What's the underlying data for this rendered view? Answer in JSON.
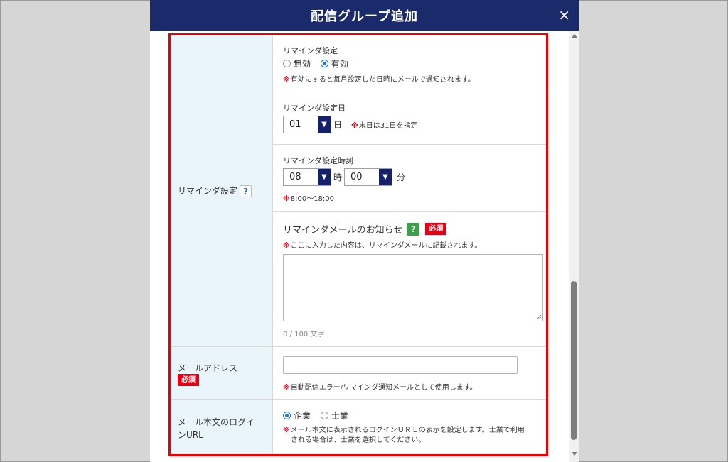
{
  "modal": {
    "title": "配信グループ追加",
    "close_glyph": "×"
  },
  "reminder": {
    "section_label": "リマインダ設定",
    "help_glyph": "?",
    "setting": {
      "label": "リマインダ設定",
      "options": [
        "無効",
        "有効"
      ],
      "selected": "有効",
      "note_mark": "※",
      "note": "有効にすると毎月設定した日時にメールで通知されます。"
    },
    "day": {
      "label": "リマインダ設定日",
      "value": "01",
      "unit": "日",
      "note_mark": "※",
      "note": "末日は31日を指定"
    },
    "time": {
      "label": "リマインダ設定時刻",
      "hour": "08",
      "hour_unit": "時",
      "minute": "00",
      "minute_unit": "分",
      "note_mark": "※",
      "note": "8:00〜18:00"
    },
    "message": {
      "label": "リマインダメールのお知らせ",
      "help_glyph": "?",
      "required": "必須",
      "note_mark": "※",
      "note": "ここに入力した内容は、リマインダメールに記載されます。",
      "value": "",
      "counter": "0 / 100 文字"
    }
  },
  "email": {
    "label": "メールアドレス",
    "required": "必須",
    "value": "",
    "note_mark": "※",
    "note": "自動配信エラー/リマインダ通知メールとして使用します。"
  },
  "login_url": {
    "label_line1": "メール本文のログイ",
    "label_line2": "ンURL",
    "options": [
      "企業",
      "士業"
    ],
    "selected": "企業",
    "note_mark": "※",
    "note_line1": "メール本文に表示されるログインＵＲＬの表示を設定します。士業で利用",
    "note_line2": "される場合は、士業を選択してください。"
  },
  "colors": {
    "header_bg": "#1b2a6b",
    "highlight_border": "#ee0000",
    "label_bg": "#eaf4fb",
    "required_bg": "#e60012",
    "radio_accent": "#1a73e8",
    "select_arrow_bg": "#15206b"
  },
  "icons": {
    "close": "close-icon",
    "help": "question-icon",
    "select_arrow": "chevron-down-icon",
    "note": "asterisk-icon"
  }
}
